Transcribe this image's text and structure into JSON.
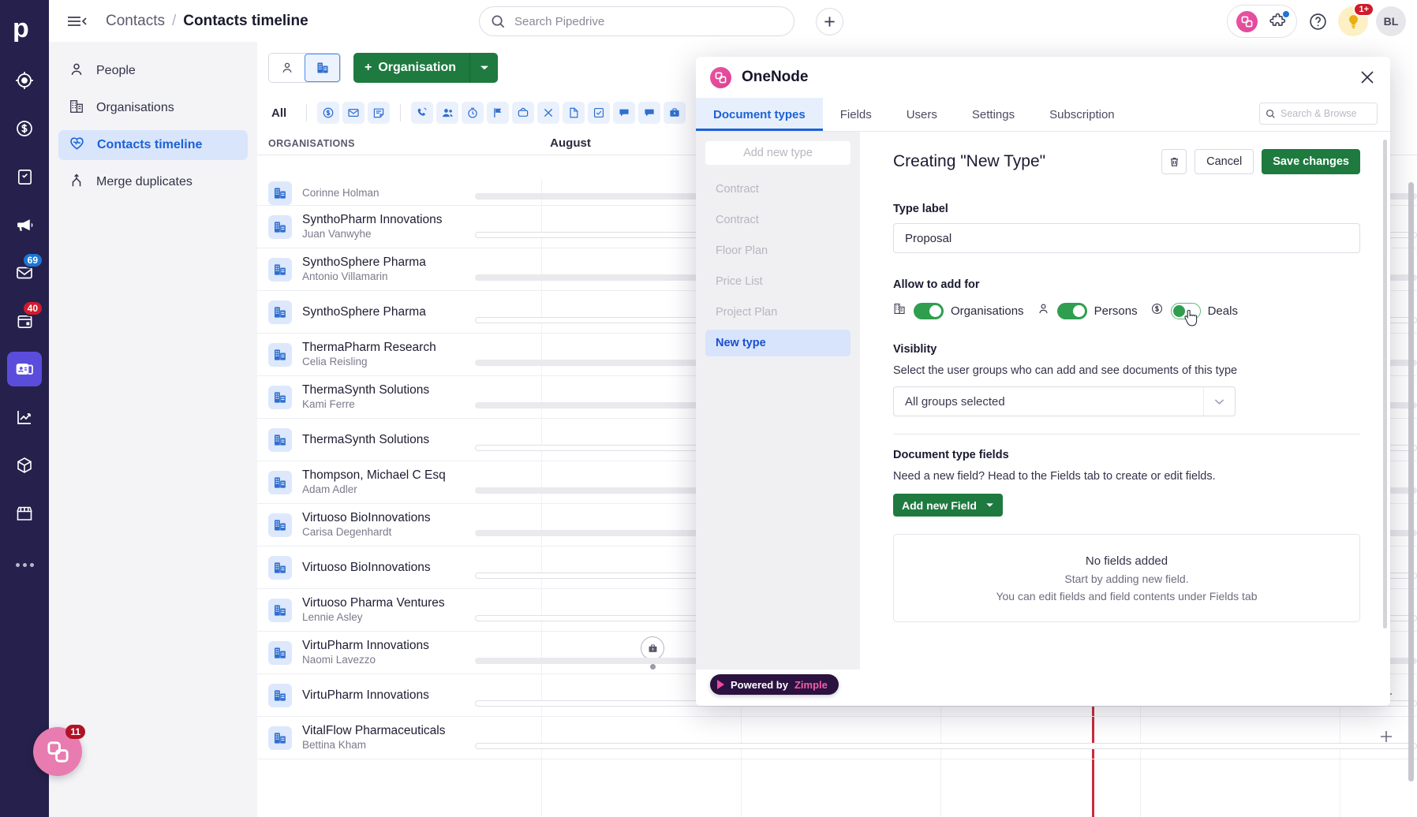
{
  "colors": {
    "brand_green": "#1e7a3f",
    "accent_blue": "#1b62d6",
    "pink": "#e8569f",
    "rail_bg": "#25214c",
    "today_line": "#cc2a3c"
  },
  "topbar": {
    "breadcrumb_root": "Contacts",
    "breadcrumb_sep": "/",
    "breadcrumb_current": "Contacts timeline",
    "search_placeholder": "Search Pipedrive",
    "search_value": "",
    "bulb_badge": "1+",
    "avatar_initials": "BL"
  },
  "rail": {
    "items": [
      {
        "name": "logo",
        "badge": ""
      },
      {
        "name": "leads",
        "badge": ""
      },
      {
        "name": "deals",
        "badge": ""
      },
      {
        "name": "projects",
        "badge": ""
      },
      {
        "name": "campaigns",
        "badge": ""
      },
      {
        "name": "mail",
        "badge": "69"
      },
      {
        "name": "activities",
        "badge": "40"
      },
      {
        "name": "contacts",
        "badge": ""
      },
      {
        "name": "insights",
        "badge": ""
      },
      {
        "name": "products",
        "badge": ""
      },
      {
        "name": "marketplace",
        "badge": ""
      },
      {
        "name": "more",
        "badge": ""
      }
    ]
  },
  "subnav": {
    "items": [
      {
        "label": "People",
        "icon": "person-icon",
        "active": false
      },
      {
        "label": "Organisations",
        "icon": "building-icon",
        "active": false
      },
      {
        "label": "Contacts timeline",
        "icon": "heartbeat-icon",
        "active": true
      },
      {
        "label": "Merge duplicates",
        "icon": "merge-icon",
        "active": false
      }
    ]
  },
  "toolbar": {
    "add_button_label": "Organisation",
    "add_button_plus": "+",
    "filter_all_label": "All"
  },
  "table": {
    "col_org_header": "ORGANISATIONS",
    "col_month_header": "August",
    "rows": [
      {
        "name": "",
        "person": "Corinne Holman",
        "clipped": true
      },
      {
        "name": "SynthoPharm Innovations",
        "person": "Juan Vanwyhe"
      },
      {
        "name": "SynthoSphere Pharma",
        "person": "Antonio Villamarin"
      },
      {
        "name": "SynthoSphere Pharma",
        "person": ""
      },
      {
        "name": "ThermaPharm Research",
        "person": "Celia Reisling"
      },
      {
        "name": "ThermaSynth Solutions",
        "person": "Kami Ferre"
      },
      {
        "name": "ThermaSynth Solutions",
        "person": ""
      },
      {
        "name": "Thompson, Michael C Esq",
        "person": "Adam Adler"
      },
      {
        "name": "Virtuoso BioInnovations",
        "person": "Carisa Degenhardt"
      },
      {
        "name": "Virtuoso BioInnovations",
        "person": ""
      },
      {
        "name": "Virtuoso Pharma Ventures",
        "person": "Lennie Asley"
      },
      {
        "name": "VirtuPharm Innovations",
        "person": "Naomi Lavezzo",
        "deal_chip": true
      },
      {
        "name": "VirtuPharm Innovations",
        "person": "",
        "plus": true
      },
      {
        "name": "VitalFlow Pharmaceuticals",
        "person": "Bettina Kham",
        "plus": true
      }
    ]
  },
  "chat_widget": {
    "badge": "11"
  },
  "modal": {
    "title": "OneNode",
    "close_label": "×",
    "tabs": [
      {
        "label": "Document types",
        "active": true
      },
      {
        "label": "Fields",
        "active": false
      },
      {
        "label": "Users",
        "active": false
      },
      {
        "label": "Settings",
        "active": false
      },
      {
        "label": "Subscription",
        "active": false
      }
    ],
    "search_placeholder": "Search & Browse",
    "sidebar": {
      "add_new_label": "Add new type",
      "types": [
        {
          "label": "Contract",
          "active": false
        },
        {
          "label": "Contract",
          "active": false
        },
        {
          "label": "Floor Plan",
          "active": false
        },
        {
          "label": "Price List",
          "active": false
        },
        {
          "label": "Project Plan",
          "active": false
        },
        {
          "label": "New type",
          "active": true
        }
      ]
    },
    "content": {
      "heading": "Creating \"New Type\"",
      "delete_icon": "trash-icon",
      "cancel_label": "Cancel",
      "save_label": "Save changes",
      "type_label_caption": "Type label",
      "type_label_value": "Proposal",
      "type_label_placeholder": "Type label",
      "allow_caption": "Allow to add for",
      "toggles": [
        {
          "label": "Organisations",
          "icon": "building-icon",
          "state": "on"
        },
        {
          "label": "Persons",
          "icon": "person-icon",
          "state": "on"
        },
        {
          "label": "Deals",
          "icon": "dollar-icon",
          "state": "off"
        }
      ],
      "visibility_caption": "Visiblity",
      "visibility_help": "Select the user groups who can add and see documents of this type",
      "visibility_value": "All groups selected",
      "fields_caption": "Document type fields",
      "fields_help": "Need a new field? Head to the Fields tab to create or edit fields.",
      "add_field_label": "Add new Field",
      "empty_title": "No fields added",
      "empty_line1": "Start by adding new field.",
      "empty_line2": "You can edit fields and field contents under Fields tab"
    },
    "powered_by": {
      "prefix": "Powered by",
      "brand": "Zimple"
    }
  }
}
